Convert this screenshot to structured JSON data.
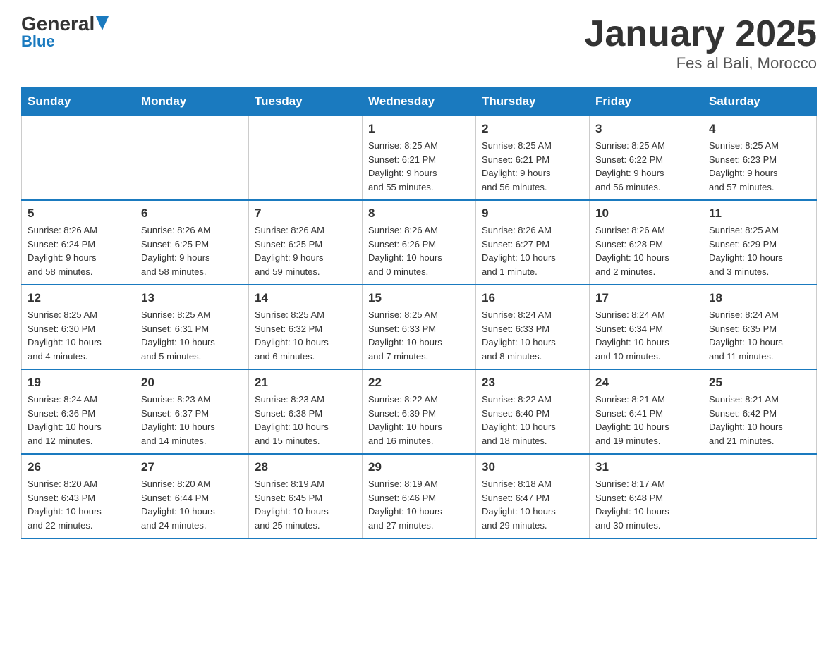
{
  "header": {
    "logo_main": "General",
    "logo_sub": "Blue",
    "month_year": "January 2025",
    "location": "Fes al Bali, Morocco"
  },
  "weekdays": [
    "Sunday",
    "Monday",
    "Tuesday",
    "Wednesday",
    "Thursday",
    "Friday",
    "Saturday"
  ],
  "weeks": [
    [
      {
        "day": "",
        "info": ""
      },
      {
        "day": "",
        "info": ""
      },
      {
        "day": "",
        "info": ""
      },
      {
        "day": "1",
        "info": "Sunrise: 8:25 AM\nSunset: 6:21 PM\nDaylight: 9 hours\nand 55 minutes."
      },
      {
        "day": "2",
        "info": "Sunrise: 8:25 AM\nSunset: 6:21 PM\nDaylight: 9 hours\nand 56 minutes."
      },
      {
        "day": "3",
        "info": "Sunrise: 8:25 AM\nSunset: 6:22 PM\nDaylight: 9 hours\nand 56 minutes."
      },
      {
        "day": "4",
        "info": "Sunrise: 8:25 AM\nSunset: 6:23 PM\nDaylight: 9 hours\nand 57 minutes."
      }
    ],
    [
      {
        "day": "5",
        "info": "Sunrise: 8:26 AM\nSunset: 6:24 PM\nDaylight: 9 hours\nand 58 minutes."
      },
      {
        "day": "6",
        "info": "Sunrise: 8:26 AM\nSunset: 6:25 PM\nDaylight: 9 hours\nand 58 minutes."
      },
      {
        "day": "7",
        "info": "Sunrise: 8:26 AM\nSunset: 6:25 PM\nDaylight: 9 hours\nand 59 minutes."
      },
      {
        "day": "8",
        "info": "Sunrise: 8:26 AM\nSunset: 6:26 PM\nDaylight: 10 hours\nand 0 minutes."
      },
      {
        "day": "9",
        "info": "Sunrise: 8:26 AM\nSunset: 6:27 PM\nDaylight: 10 hours\nand 1 minute."
      },
      {
        "day": "10",
        "info": "Sunrise: 8:26 AM\nSunset: 6:28 PM\nDaylight: 10 hours\nand 2 minutes."
      },
      {
        "day": "11",
        "info": "Sunrise: 8:25 AM\nSunset: 6:29 PM\nDaylight: 10 hours\nand 3 minutes."
      }
    ],
    [
      {
        "day": "12",
        "info": "Sunrise: 8:25 AM\nSunset: 6:30 PM\nDaylight: 10 hours\nand 4 minutes."
      },
      {
        "day": "13",
        "info": "Sunrise: 8:25 AM\nSunset: 6:31 PM\nDaylight: 10 hours\nand 5 minutes."
      },
      {
        "day": "14",
        "info": "Sunrise: 8:25 AM\nSunset: 6:32 PM\nDaylight: 10 hours\nand 6 minutes."
      },
      {
        "day": "15",
        "info": "Sunrise: 8:25 AM\nSunset: 6:33 PM\nDaylight: 10 hours\nand 7 minutes."
      },
      {
        "day": "16",
        "info": "Sunrise: 8:24 AM\nSunset: 6:33 PM\nDaylight: 10 hours\nand 8 minutes."
      },
      {
        "day": "17",
        "info": "Sunrise: 8:24 AM\nSunset: 6:34 PM\nDaylight: 10 hours\nand 10 minutes."
      },
      {
        "day": "18",
        "info": "Sunrise: 8:24 AM\nSunset: 6:35 PM\nDaylight: 10 hours\nand 11 minutes."
      }
    ],
    [
      {
        "day": "19",
        "info": "Sunrise: 8:24 AM\nSunset: 6:36 PM\nDaylight: 10 hours\nand 12 minutes."
      },
      {
        "day": "20",
        "info": "Sunrise: 8:23 AM\nSunset: 6:37 PM\nDaylight: 10 hours\nand 14 minutes."
      },
      {
        "day": "21",
        "info": "Sunrise: 8:23 AM\nSunset: 6:38 PM\nDaylight: 10 hours\nand 15 minutes."
      },
      {
        "day": "22",
        "info": "Sunrise: 8:22 AM\nSunset: 6:39 PM\nDaylight: 10 hours\nand 16 minutes."
      },
      {
        "day": "23",
        "info": "Sunrise: 8:22 AM\nSunset: 6:40 PM\nDaylight: 10 hours\nand 18 minutes."
      },
      {
        "day": "24",
        "info": "Sunrise: 8:21 AM\nSunset: 6:41 PM\nDaylight: 10 hours\nand 19 minutes."
      },
      {
        "day": "25",
        "info": "Sunrise: 8:21 AM\nSunset: 6:42 PM\nDaylight: 10 hours\nand 21 minutes."
      }
    ],
    [
      {
        "day": "26",
        "info": "Sunrise: 8:20 AM\nSunset: 6:43 PM\nDaylight: 10 hours\nand 22 minutes."
      },
      {
        "day": "27",
        "info": "Sunrise: 8:20 AM\nSunset: 6:44 PM\nDaylight: 10 hours\nand 24 minutes."
      },
      {
        "day": "28",
        "info": "Sunrise: 8:19 AM\nSunset: 6:45 PM\nDaylight: 10 hours\nand 25 minutes."
      },
      {
        "day": "29",
        "info": "Sunrise: 8:19 AM\nSunset: 6:46 PM\nDaylight: 10 hours\nand 27 minutes."
      },
      {
        "day": "30",
        "info": "Sunrise: 8:18 AM\nSunset: 6:47 PM\nDaylight: 10 hours\nand 29 minutes."
      },
      {
        "day": "31",
        "info": "Sunrise: 8:17 AM\nSunset: 6:48 PM\nDaylight: 10 hours\nand 30 minutes."
      },
      {
        "day": "",
        "info": ""
      }
    ]
  ]
}
